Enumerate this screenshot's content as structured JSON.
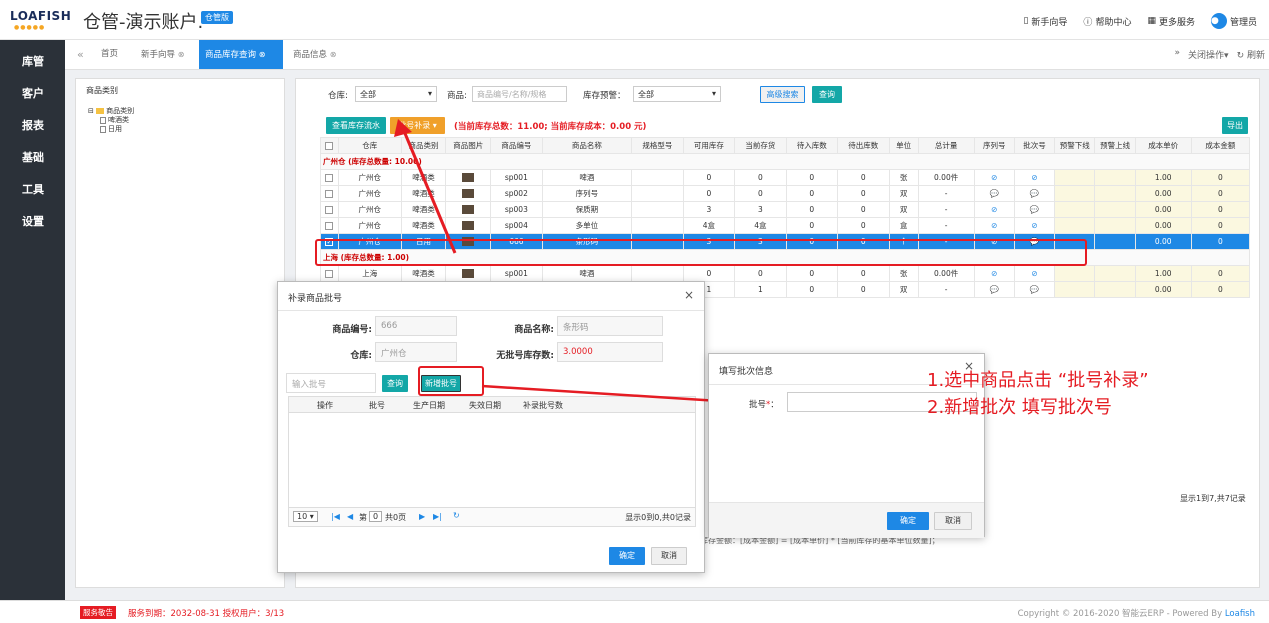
{
  "header": {
    "logo": "LOAFISH",
    "title": "仓管-演示账户.",
    "badge": "仓管版",
    "menu": [
      "新手向导",
      "帮助中心",
      "更多服务",
      "管理员"
    ]
  },
  "sidebar": {
    "items": [
      "库管",
      "客户",
      "报表",
      "基础",
      "工具",
      "设置"
    ]
  },
  "tabs": {
    "items": [
      "首页",
      "新手向导",
      "商品库存查询",
      "商品信息"
    ],
    "active": "商品库存查询",
    "right": [
      "关闭操作▾",
      "刷新"
    ]
  },
  "category_panel": {
    "title": "商品类别",
    "tree": [
      "商品类别",
      "啤酒类",
      "日用"
    ]
  },
  "filters": {
    "warehouse_label": "仓库:",
    "warehouse_value": "全部",
    "goods_label": "商品:",
    "goods_placeholder": "商品编号/名称/规格",
    "alert_label": "库存预警：",
    "alert_value": "全部",
    "advanced": "高级搜索",
    "query": "查询"
  },
  "toolbar": {
    "flow": "查看库存流水",
    "batch": "批号补录 ▾",
    "summary": "(当前库存总数：11.00;  当前库存成本：0.00 元)",
    "export": "导出"
  },
  "table": {
    "columns": [
      "",
      "仓库",
      "商品类别",
      "商品图片",
      "商品编号",
      "商品名称",
      "规格型号",
      "可用库存",
      "当前存货",
      "待入库数",
      "待出库数",
      "单位",
      "总计量",
      "序列号",
      "批次号",
      "预警下线",
      "预警上线",
      "成本单价",
      "成本金额"
    ],
    "groups": [
      {
        "label": "广州仓 (库存总数量: 10.00)",
        "rows": [
          {
            "wh": "广州仓",
            "cat": "啤酒类",
            "code": "sp001",
            "name": "啤酒",
            "avail": "0",
            "cur": "0",
            "in": "0",
            "out": "0",
            "unit": "张",
            "total": "0.00件",
            "sn": "⊘",
            "bn": "⊘",
            "price": "1.00",
            "amount": "0",
            "selected": false
          },
          {
            "wh": "广州仓",
            "cat": "啤酒类",
            "code": "sp002",
            "name": "序列号",
            "avail": "0",
            "cur": "0",
            "in": "0",
            "out": "0",
            "unit": "双",
            "total": "-",
            "sn": "💬",
            "bn": "💬",
            "price": "0.00",
            "amount": "0",
            "selected": false
          },
          {
            "wh": "广州仓",
            "cat": "啤酒类",
            "code": "sp003",
            "name": "保质期",
            "avail": "3",
            "cur": "3",
            "in": "0",
            "out": "0",
            "unit": "双",
            "total": "-",
            "sn": "⊘",
            "bn": "💬",
            "price": "0.00",
            "amount": "0",
            "selected": false
          },
          {
            "wh": "广州仓",
            "cat": "啤酒类",
            "code": "sp004",
            "name": "多单位",
            "avail": "4盒",
            "cur": "4盒",
            "in": "0",
            "out": "0",
            "unit": "盒",
            "total": "-",
            "sn": "⊘",
            "bn": "⊘",
            "price": "0.00",
            "amount": "0",
            "selected": false
          },
          {
            "wh": "广州仓",
            "cat": "日用",
            "code": "666",
            "name": "条形码",
            "avail": "3",
            "cur": "3",
            "in": "0",
            "out": "0",
            "unit": "个",
            "total": "-",
            "sn": "⊘",
            "bn": "💬",
            "price": "0.00",
            "amount": "0",
            "selected": true
          }
        ]
      },
      {
        "label": "上海 (库存总数量: 1.00)",
        "rows": [
          {
            "wh": "上海",
            "cat": "啤酒类",
            "code": "sp001",
            "name": "啤酒",
            "avail": "0",
            "cur": "0",
            "in": "0",
            "out": "0",
            "unit": "张",
            "total": "0.00件",
            "sn": "⊘",
            "bn": "⊘",
            "price": "1.00",
            "amount": "0",
            "selected": false
          },
          {
            "wh": "上海",
            "cat": "啤酒类",
            "code": "sp002",
            "name": "序列号",
            "avail": "1",
            "cur": "1",
            "in": "0",
            "out": "0",
            "unit": "双",
            "total": "-",
            "sn": "💬",
            "bn": "💬",
            "price": "0.00",
            "amount": "0",
            "selected": false
          }
        ]
      }
    ],
    "pager_text": "显示1到7,共7记录",
    "formula_text": "库存金额：[成本金额] = [成本单价] * [当前库存的基本单位数量]；"
  },
  "modal_batch": {
    "title": "补录商品批号",
    "code_label": "商品编号:",
    "code_value": "666",
    "name_label": "商品名称:",
    "name_value": "条形码",
    "wh_label": "仓库:",
    "wh_value": "广州仓",
    "nobatch_label": "无批号库存数:",
    "nobatch_value": "3.0000",
    "batch_placeholder": "输入批号",
    "query": "查询",
    "add": "新增批号",
    "columns": [
      "操作",
      "批号",
      "生产日期",
      "失效日期",
      "补录批号数"
    ],
    "page_size": "10",
    "page_prefix": "第",
    "page_no": "0",
    "page_suffix": "共0页",
    "pager_text": "显示0到0,共0记录",
    "ok": "确定",
    "cancel": "取消"
  },
  "modal_fill": {
    "title": "填写批次信息",
    "batch_label": "批号",
    "ok": "确定",
    "cancel": "取消"
  },
  "annotation": {
    "line1": "1.选中商品点击 “批号补录”",
    "line2": "2.新增批次 填写批次号"
  },
  "footer": {
    "badge": "服务敬告",
    "expiry": "服务到期：2032-08-31  授权用户：3/13",
    "copyright": "Copyright © 2016-2020 智能云ERP - Powered By ",
    "brand": "Loafish"
  },
  "colors": {
    "accent": "#1e88e5",
    "sidebar": "#2b3139",
    "alert": "#e51c23",
    "teal": "#13a7a7",
    "orange": "#f0a02a"
  }
}
